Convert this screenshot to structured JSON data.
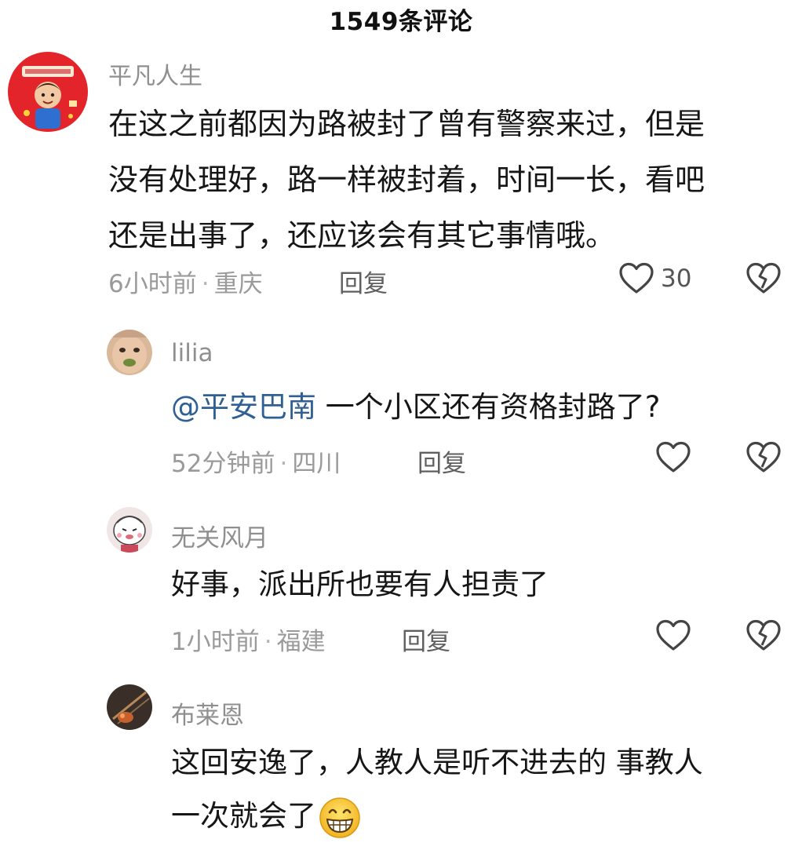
{
  "header": {
    "title": "1549条评论"
  },
  "main_comment": {
    "username": "平凡人生",
    "lines": [
      "在这之前都因为路被封了曾有警察来过，但是",
      "没有处理好，路一样被封着，时间一长，看吧",
      "还是出事了，还应该会有其它事情哦。"
    ],
    "time": "6小时前",
    "location": "重庆",
    "reply_label": "回复",
    "like_count": "30",
    "avatar_icon": "cartoon-boy-avatar-icon"
  },
  "replies": [
    {
      "username": "lilia",
      "mention": "@平安巴南",
      "text": " 一个小区还有资格封路了?",
      "time": "52分钟前",
      "location": "四川",
      "reply_label": "回复"
    },
    {
      "username": "无关风月",
      "text": "好事，派出所也要有人担责了",
      "time": "1小时前",
      "location": "福建",
      "reply_label": "回复"
    },
    {
      "username": "布莱恩",
      "lines": [
        "这回安逸了，人教人是听不进去的 事教人",
        "一次就会了"
      ],
      "emoji_icon": "grinning-face-emoji-icon"
    }
  ],
  "meta_separator": "·",
  "colors": {
    "username": "#8f8f8f",
    "mention": "#2f5f93",
    "meta": "#9a9a9a",
    "icon": "#444444"
  }
}
